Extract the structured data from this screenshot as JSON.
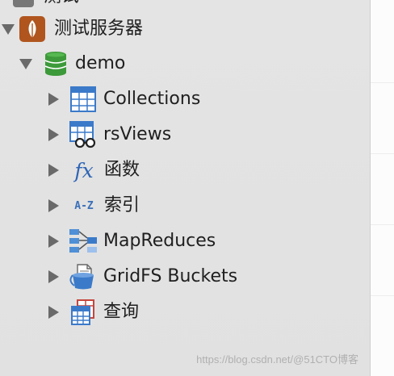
{
  "tree": {
    "top_partial_label": "测试",
    "server": {
      "label": "测试服务器",
      "icon": "mongodb-leaf-icon"
    },
    "database": {
      "label": "demo",
      "icon": "database-icon"
    },
    "items": [
      {
        "label": "Collections",
        "icon": "table-grid-icon"
      },
      {
        "label": "rsViews",
        "icon": "view-glasses-icon"
      },
      {
        "label": "函数",
        "icon": "function-fx-icon"
      },
      {
        "label": "索引",
        "icon": "index-az-icon"
      },
      {
        "label": "MapReduces",
        "icon": "mapreduce-icon"
      },
      {
        "label": "GridFS Buckets",
        "icon": "gridfs-bucket-icon"
      },
      {
        "label": "查询",
        "icon": "query-table-icon"
      }
    ],
    "az_text": "A-Z",
    "fx_text": "fx"
  },
  "watermark": "https://blog.csdn.net/@51CTO博客",
  "colors": {
    "server_icon": "#b0551e",
    "database_icon": "#3d9a3a",
    "table_icon": "#3b7ac9",
    "text": "#1f1f1f"
  }
}
